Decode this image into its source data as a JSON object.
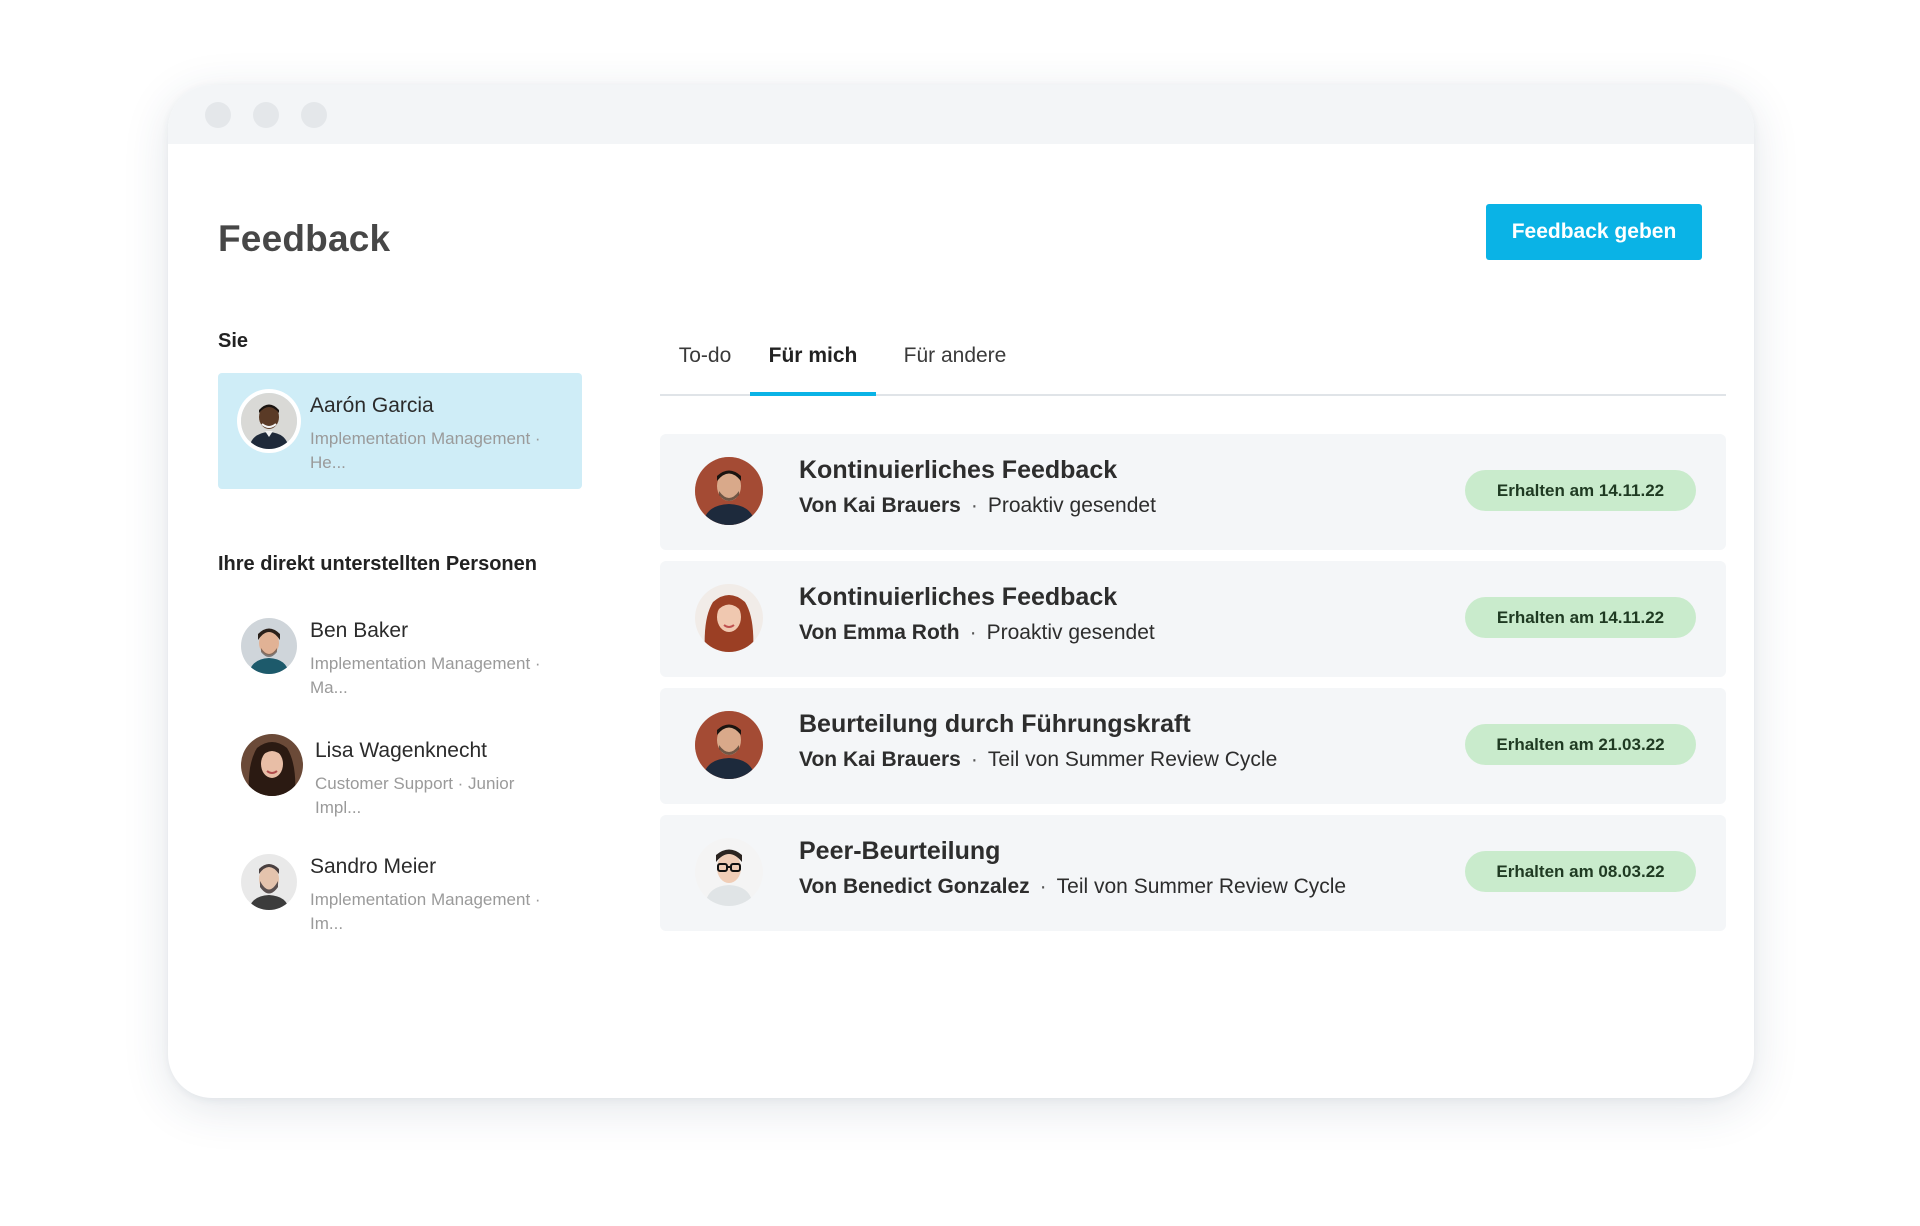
{
  "header": {
    "title": "Feedback",
    "primary_button": "Feedback geben"
  },
  "sidebar": {
    "you_label": "Sie",
    "you": {
      "name": "Aarón Garcia",
      "role": "Implementation Management · He..."
    },
    "reports_label": "Ihre direkt unterstellten Personen",
    "reports": [
      {
        "name": "Ben Baker",
        "role": "Implementation Management · Ma..."
      },
      {
        "name": "Lisa Wagenknecht",
        "role": "Customer Support · Junior Impl..."
      },
      {
        "name": "Sandro Meier",
        "role": "Implementation Management · Im..."
      }
    ]
  },
  "tabs": [
    {
      "label": "To-do",
      "active": false
    },
    {
      "label": "Für mich",
      "active": true
    },
    {
      "label": "Für andere",
      "active": false
    }
  ],
  "feedback_items": [
    {
      "title": "Kontinuierliches Feedback",
      "author": "Von Kai Brauers",
      "separator": "·",
      "context": "Proaktiv gesendet",
      "badge": "Erhalten am 14.11.22"
    },
    {
      "title": "Kontinuierliches Feedback",
      "author": "Von Emma Roth",
      "separator": "·",
      "context": "Proaktiv gesendet",
      "badge": "Erhalten am 14.11.22"
    },
    {
      "title": "Beurteilung durch Führungskraft",
      "author": "Von Kai Brauers",
      "separator": "·",
      "context": "Teil von Summer Review Cycle",
      "badge": "Erhalten am 21.03.22"
    },
    {
      "title": "Peer-Beurteilung",
      "author": "Von Benedict Gonzalez",
      "separator": "·",
      "context": "Teil von Summer Review Cycle",
      "badge": "Erhalten am 08.03.22"
    }
  ],
  "colors": {
    "accent": "#0ab3e6",
    "selected_card": "#cfedf7",
    "badge_bg": "#c9ebcc",
    "row_bg": "#f4f6f8"
  }
}
